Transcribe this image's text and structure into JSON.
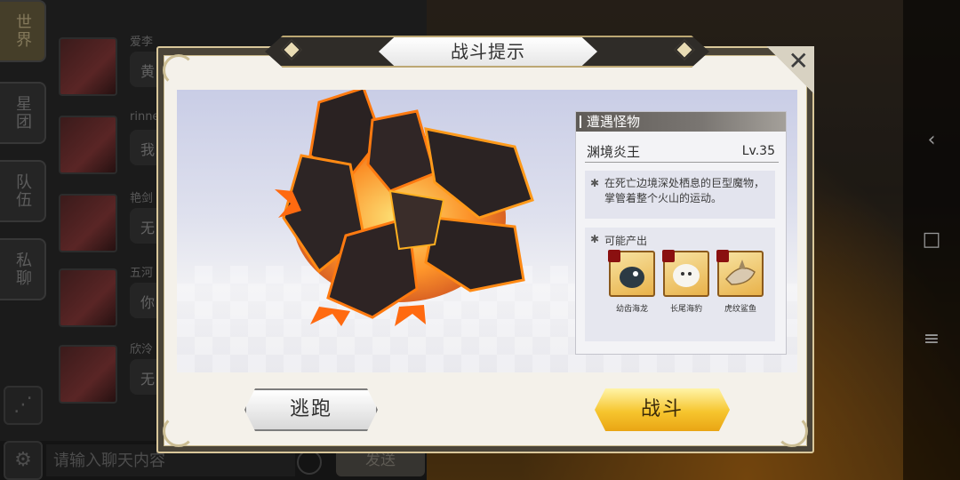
{
  "chat": {
    "tabs": [
      {
        "label": "世界"
      },
      {
        "label": "星团"
      },
      {
        "label": "队伍"
      },
      {
        "label": "私聊"
      }
    ],
    "rows": [
      {
        "name": "爱李",
        "bubble": "黄"
      },
      {
        "name": "rinne",
        "bubble": "我"
      },
      {
        "name": "艳剑",
        "bubble": "无"
      },
      {
        "name": "五河",
        "bubble": "你"
      },
      {
        "name": "欣泠",
        "bubble": "无"
      }
    ],
    "input_placeholder": "请输入聊天内容",
    "send_label": "发送"
  },
  "dialog": {
    "title": "战斗提示",
    "close_symbol": "✕",
    "info": {
      "header": "遭遇怪物",
      "monster_name": "渊境炎王",
      "monster_level": "Lv.35",
      "description": "在死亡边境深处栖息的巨型魔物，掌管着整个火山的运动。",
      "drops_title": "可能产出",
      "drops": [
        {
          "name": "幼齿海龙",
          "icon": "sea-dragon-icon"
        },
        {
          "name": "长尾海豹",
          "icon": "seal-icon"
        },
        {
          "name": "虎纹鲨鱼",
          "icon": "shark-icon"
        }
      ]
    },
    "escape_label": "逃跑",
    "fight_label": "战斗"
  },
  "system_nav": {
    "back_icon": "‹",
    "home_icon": "□",
    "menu_icon": "≡"
  }
}
